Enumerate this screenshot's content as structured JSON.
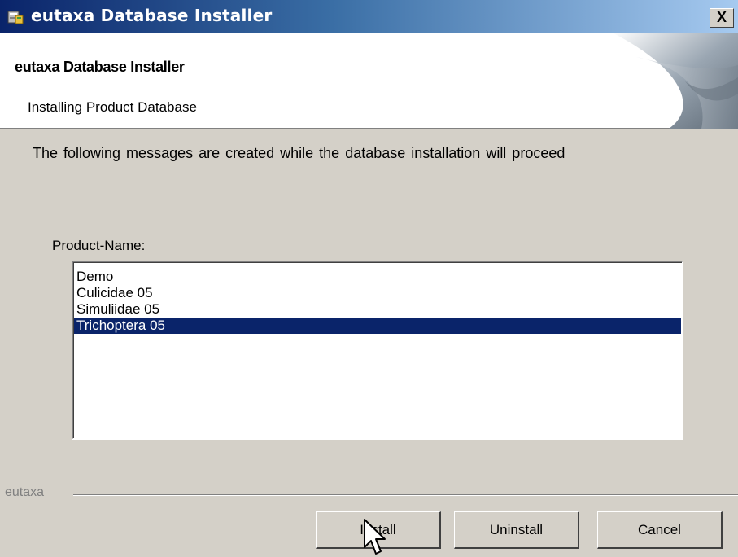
{
  "window": {
    "title": "eutaxa Database Installer",
    "close_label": "X"
  },
  "header": {
    "title": "eutaxa Database Installer",
    "subtitle": "Installing Product Database"
  },
  "body": {
    "message": "The following messages are created while the database installation will proceed",
    "product_label": "Product-Name:",
    "products": [
      "Demo",
      "Culicidae 05",
      "Simuliidae 05",
      "Trichoptera 05"
    ],
    "selected_product": "Trichoptera 05"
  },
  "footer": {
    "brand": "eutaxa",
    "install_label": "Install",
    "uninstall_label": "Uninstall",
    "cancel_label": "Cancel"
  },
  "colors": {
    "titlebar_start": "#0a246a",
    "titlebar_end": "#a6caf0",
    "selection": "#0a246a",
    "face": "#d4d0c8"
  },
  "icons": {
    "app": "installer-box-icon",
    "close": "close-icon",
    "cursor": "mouse-pointer-icon"
  }
}
